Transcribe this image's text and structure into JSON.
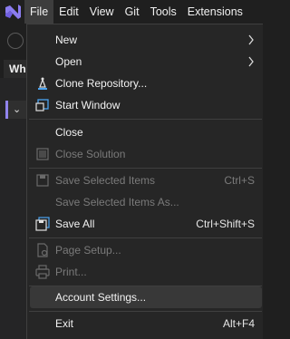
{
  "menubar": {
    "items": [
      {
        "label": "File",
        "active": true
      },
      {
        "label": "Edit"
      },
      {
        "label": "View"
      },
      {
        "label": "Git"
      },
      {
        "label": "Tools"
      },
      {
        "label": "Extensions"
      }
    ]
  },
  "background": {
    "panel_title": "Wh"
  },
  "file_menu": {
    "items": [
      {
        "label": "New",
        "submenu": true,
        "icon": "none"
      },
      {
        "label": "Open",
        "submenu": true,
        "icon": "none"
      },
      {
        "label": "Clone Repository...",
        "icon": "clone-repository-icon"
      },
      {
        "label": "Start Window",
        "icon": "start-window-icon"
      },
      {
        "label": "Close"
      },
      {
        "label": "Close Solution",
        "disabled": true,
        "icon": "close-solution-icon"
      },
      {
        "label": "Save Selected Items",
        "shortcut": "Ctrl+S",
        "disabled": true,
        "icon": "save-icon"
      },
      {
        "label": "Save Selected Items As...",
        "disabled": true
      },
      {
        "label": "Save All",
        "shortcut": "Ctrl+Shift+S",
        "icon": "save-all-icon"
      },
      {
        "label": "Page Setup...",
        "disabled": true,
        "icon": "page-setup-icon"
      },
      {
        "label": "Print...",
        "disabled": true,
        "icon": "print-icon"
      },
      {
        "label": "Account Settings...",
        "hover": true
      },
      {
        "label": "Exit",
        "shortcut": "Alt+F4"
      }
    ]
  },
  "colors": {
    "accent": "#9184ee",
    "menu_bg": "#262626",
    "hover_bg": "#383838"
  }
}
